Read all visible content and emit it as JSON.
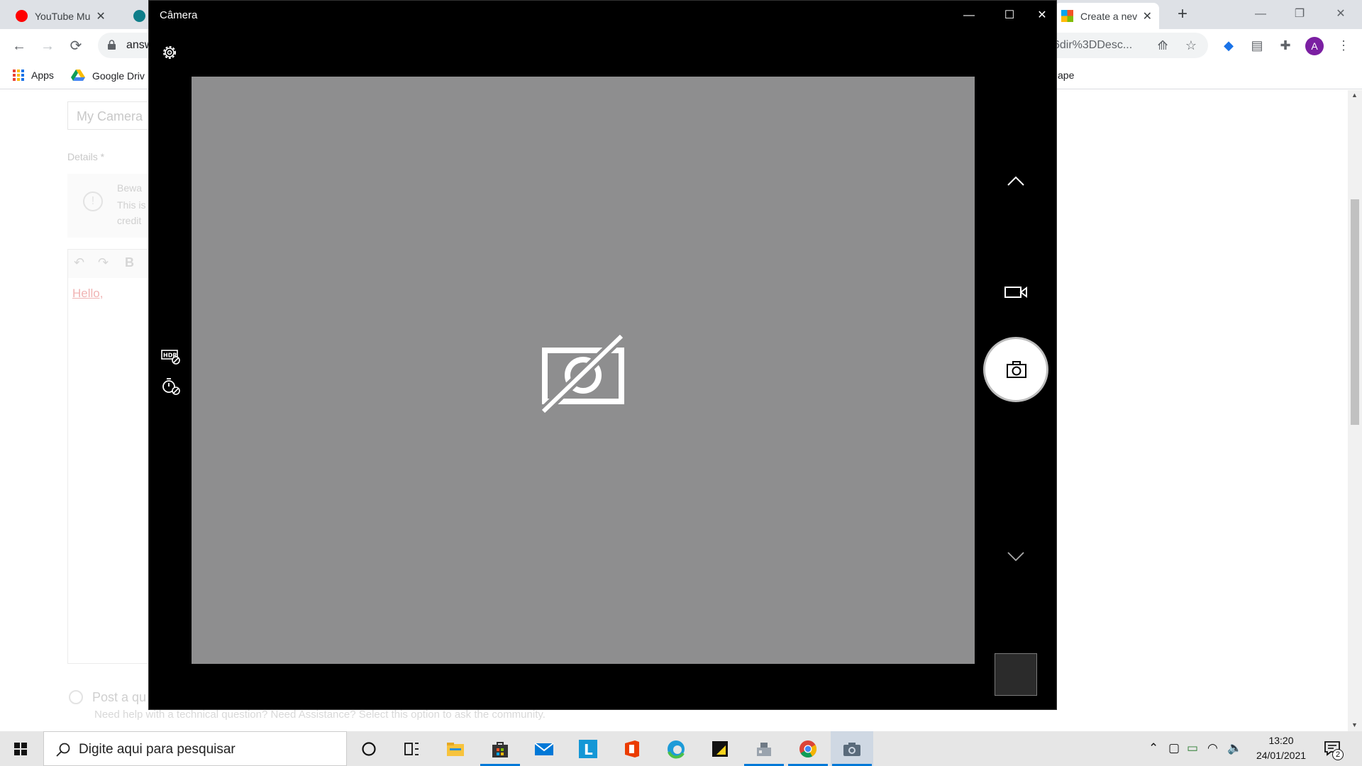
{
  "browser": {
    "tabs": [
      {
        "label": "YouTube Mu",
        "favicon_color": "#ff0000"
      },
      {
        "label": "",
        "favicon_color": "#0f7e8a"
      },
      {
        "label": "Create a nev",
        "favicon_color": "#f35325",
        "active": true
      }
    ],
    "new_tab_symbol": "+",
    "url_left": "answ",
    "url_right": "6dir%3DDesc...",
    "bookmarks": {
      "apps": "Apps",
      "drive": "Google Driv",
      "partial_right": "ape"
    }
  },
  "page": {
    "title_input_value": "My Camera",
    "details_label": "Details *",
    "beware_title": "Bewa",
    "beware_text1": "This is",
    "beware_text2": "credit",
    "editor_text": "Hello,",
    "post_option_label": "Post a qu",
    "post_option_help": "Need help with a technical question? Need Assistance? Select this option to ask the community."
  },
  "camera": {
    "title": "Câmera",
    "viewfinder_color": "#8e8e8f",
    "icons": [
      "settings-icon",
      "hdr-icon",
      "timer-icon",
      "no-camera-icon",
      "chevron-up-icon",
      "video-mode-icon",
      "photo-capture-icon",
      "chevron-down-icon"
    ]
  },
  "taskbar": {
    "search_placeholder": "Digite aqui para pesquisar",
    "time": "13:20",
    "date": "24/01/2021",
    "notification_count": "2",
    "accent": "#0078d7"
  }
}
